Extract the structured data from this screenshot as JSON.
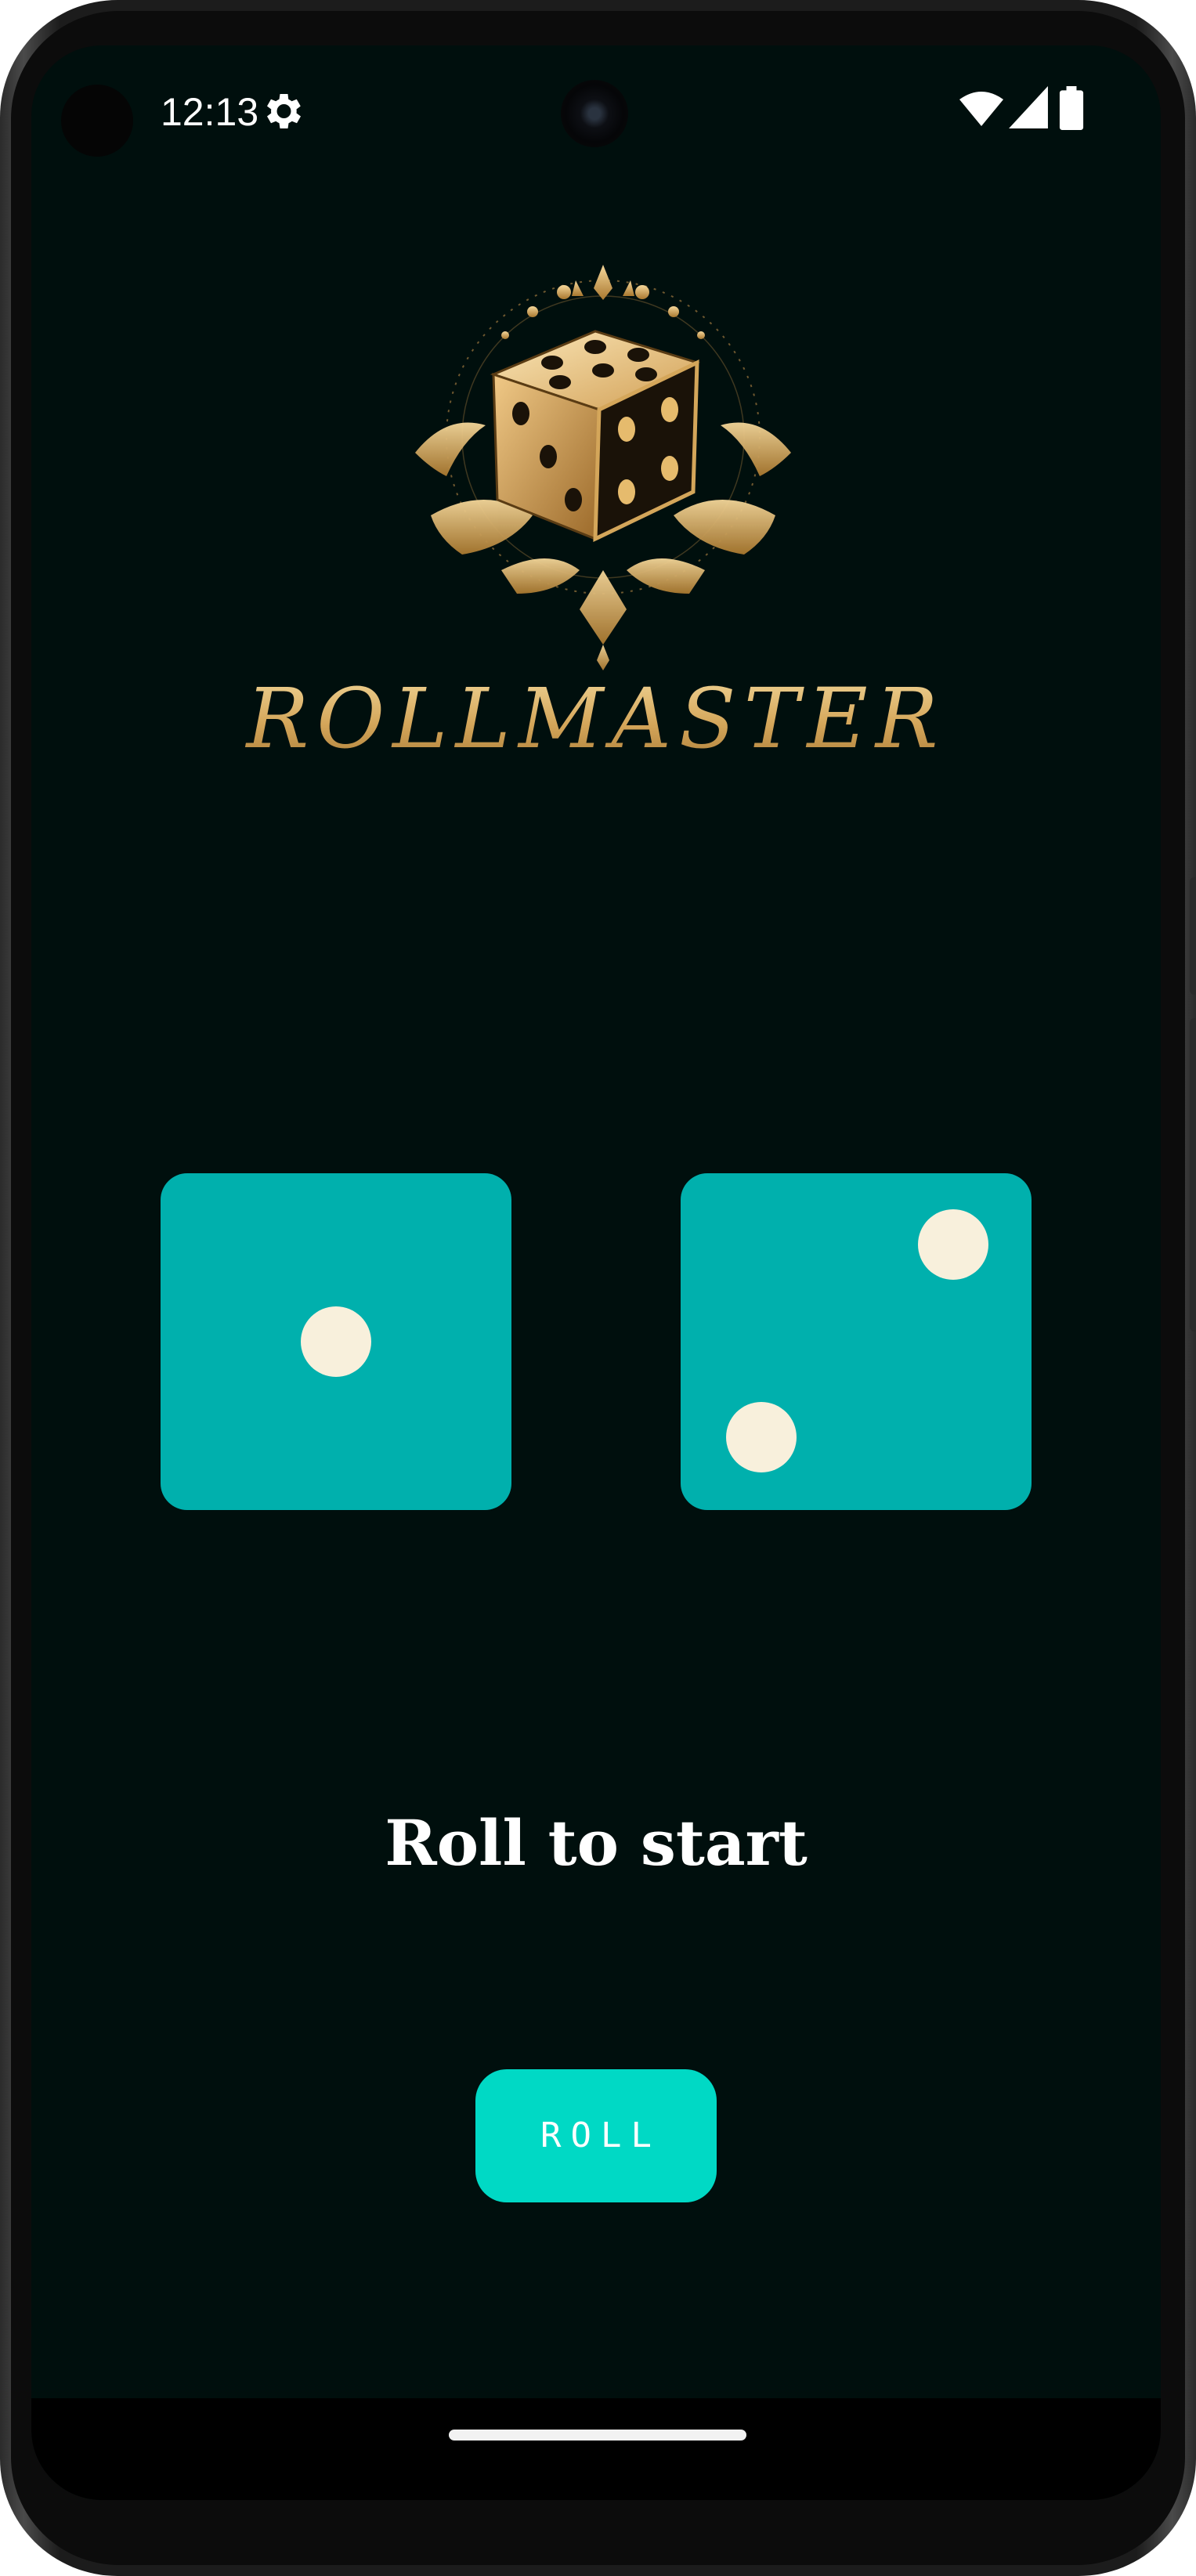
{
  "status_bar": {
    "time": "12:13",
    "icons": [
      "gear-icon",
      "wifi-icon",
      "signal-icon",
      "battery-icon"
    ]
  },
  "app": {
    "title": "ROLLMASTER",
    "logo_icon": "dice-emblem-icon"
  },
  "dice": [
    {
      "name": "left-die",
      "value": 1
    },
    {
      "name": "right-die",
      "value": 2
    }
  ],
  "status_message": "Roll to start",
  "roll_button_label": "ROLL",
  "colors": {
    "background": "#000f0d",
    "die_face": "#00b0ad",
    "pip": "#f8f0dc",
    "button": "#00d9c5",
    "title_gold": "#d9b06a"
  }
}
